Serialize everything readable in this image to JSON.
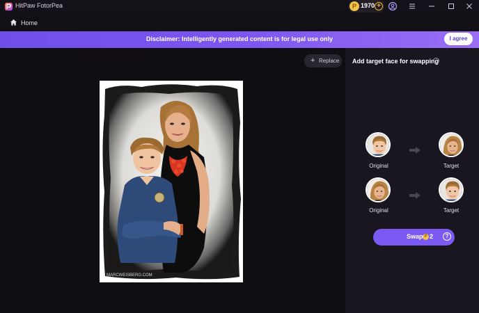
{
  "window": {
    "app_title": "HitPaw FotorPea",
    "coins": "1970",
    "coin_glyph": "P"
  },
  "nav": {
    "home_label": "Home"
  },
  "banner": {
    "text": "Disclaimer: Intelligently generated content is for legal use only",
    "agree_label": "I agree"
  },
  "canvas": {
    "replace_label": "Replace",
    "photo_watermark": "MARCWEISBERG.COM"
  },
  "panel": {
    "title": "Add target face for swapping",
    "pairs": [
      {
        "original_label": "Original",
        "target_label": "Target",
        "original_face": "boy-face",
        "target_face": "woman-face"
      },
      {
        "original_label": "Original",
        "target_label": "Target",
        "original_face": "woman-face",
        "target_face": "boy-face"
      }
    ],
    "swap_label": "Swap",
    "swap_cost": "2",
    "swap_help": "?"
  },
  "colors": {
    "accent": "#7a5af2",
    "banner_start": "#6f4ee8",
    "banner_end": "#9a6ef5",
    "coin": "#f2c34c",
    "background": "#0f0c12",
    "panel": "#1a1620"
  }
}
